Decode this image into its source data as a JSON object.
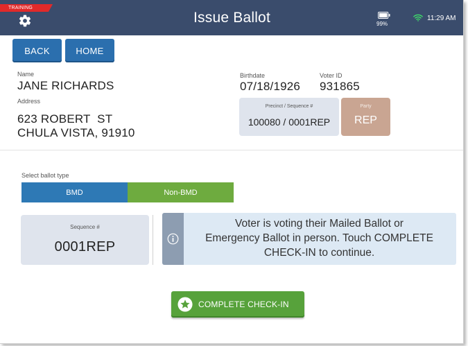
{
  "header": {
    "training_badge": "TRAINING",
    "title": "Issue Ballot",
    "battery_percent": "99%",
    "time": "11:29 AM",
    "bar_color": "#3a4c6c",
    "badge_color": "#e12a2a",
    "icons": {
      "settings": "gear-icon",
      "battery": "battery-icon",
      "wifi": "wifi-icon"
    }
  },
  "nav": {
    "back_label": "BACK",
    "home_label": "HOME",
    "button_color": "#2b6fae"
  },
  "voter": {
    "name_label": "Name",
    "name": "JANE RICHARDS",
    "address_label": "Address",
    "address_line1": "623 ROBERT  ST",
    "address_line2": "CHULA VISTA, 91910",
    "birthdate_label": "Birthdate",
    "birthdate": "07/18/1926",
    "voter_id_label": "Voter ID",
    "voter_id": "931865",
    "precinct_label": "Precinct / Sequence #",
    "precinct": "100080 / 0001REP",
    "party_label": "Party",
    "party": "REP",
    "party_color": "#c9a592"
  },
  "ballot": {
    "type_label": "Select ballot type",
    "options": [
      "BMD",
      "Non-BMD"
    ],
    "selected": "Non-BMD",
    "bmd_color": "#2e79b5",
    "nonbmd_color": "#6eab3f"
  },
  "sequence": {
    "label": "Sequence #",
    "value": "0001REP"
  },
  "message": {
    "icon": "info-icon",
    "line1": "Voter is voting their Mailed Ballot or",
    "line2": "Emergency Ballot in person. Touch COMPLETE",
    "line3": "CHECK-IN to continue."
  },
  "actions": {
    "complete_label": "COMPLETE CHECK-IN",
    "complete_icon": "star-icon",
    "complete_color": "#57a23b"
  }
}
